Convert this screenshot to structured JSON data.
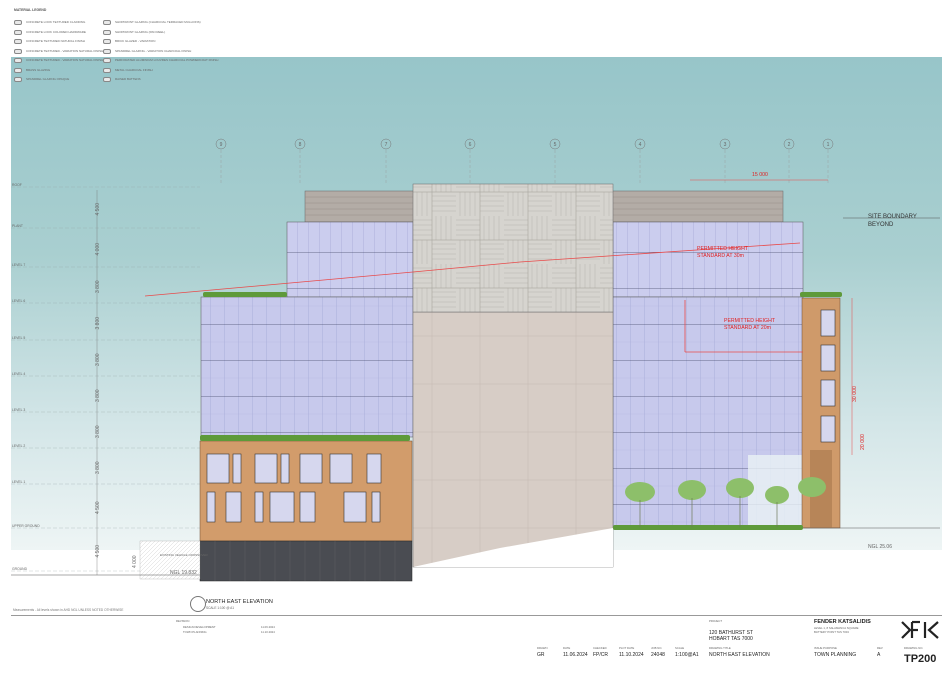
{
  "legend": {
    "title": "MATERIAL LEGEND",
    "col1": [
      "CONCRETE LOOK TEXTURED CLADDING",
      "CONCRETE LOOK COLORED HARDWARE",
      "CONCRETE TEXTURED NATURAL FINISH",
      "CONCRETE TEXTURED - VARIATION NATURAL FINISH",
      "CONCRETE TEXTURED - VARIATION NATURAL FINISH",
      "BRASS GLAZING",
      "SPANDREL GLAZING OPAQUE"
    ],
    "col2": [
      "SHOPFRONT GLAZING (CHARCOAL TERRACED MULLIONS)",
      "SHOPFRONT GLAZING (PAN REEL)",
      "BRICK GLAZED - VARIATION",
      "SPANDREL GLAZING - VARIATION CHARCOAL FINISH",
      "PERFORATED ALUMINIUM LOUVRES CHARCOAL POWDERCOAT FINISH",
      "METAL CHARCOAL FINISH",
      "RAISED BATTENS"
    ]
  },
  "grid_labels": [
    "9",
    "8",
    "7",
    "6",
    "5",
    "4",
    "3",
    "2",
    "1"
  ],
  "levels": [
    "ROOF",
    "PLANT",
    "LEVEL 7",
    "LEVEL 6",
    "LEVEL 5",
    "LEVEL 4",
    "LEVEL 3",
    "LEVEL 2",
    "LEVEL 1",
    "UPPER GROUND",
    "GROUND"
  ],
  "level_dims": [
    "4 500",
    "4 000",
    "3 800",
    "3 800",
    "3 800",
    "3 800",
    "3 800",
    "3 800",
    "4 500",
    "4 500"
  ],
  "annotations": {
    "site_boundary": "SITE BOUNDARY",
    "beyond": "BEYOND",
    "dim_top": "15 000",
    "height_30_line1": "PERMITTED HEIGHT",
    "height_30_line2": "STANDARD AT 30m",
    "height_20_line1": "PERMITTED HEIGHT",
    "height_20_line2": "STANDARD AT 20m",
    "dim_30000": "30 000",
    "dim_20000": "20 000",
    "ngl_right": "NGL 25.06",
    "ngl_left": "NGL 19.832",
    "dim_4000": "4 000",
    "existing_vehicle": "EXISTING VEHICLE CROSSOVER"
  },
  "drawing_title": "NORTH EAST ELEVATION",
  "drawing_scale": "SCALE 1:100 @ A1",
  "disclaimer": "Measurements - All levels shown in AHD NGL UNLESS NOTED OTHERWISE",
  "footer": {
    "revisions_label": "REVISION",
    "rev_rows": [
      "DESIGN DEVELOPMENT",
      "TOWN PLANNING"
    ],
    "rev_dates": [
      "11.06.2024",
      "11.10.2024"
    ],
    "drawn_label": "DRAWN",
    "drawn": "GR",
    "date_label": "DATE",
    "date": "11.06.2024",
    "checked_label": "CHECKED",
    "checked": "FP/CR",
    "plot_label": "PLOT DATE",
    "plot": "11.10.2024",
    "job_label": "JOB NO.",
    "job": "24048",
    "scale_label": "SCALE",
    "scale": "1:100@A1",
    "project_label": "PROJECT",
    "project_line1": "120 BATHURST ST",
    "project_line2": "HOBART TAS 7000",
    "drawing_label": "DRAWING TITLE",
    "drawing_title": "NORTH EAST ELEVATION",
    "firm": "FENDER KATSALIDIS",
    "firm_addr1": "LEVEL 1, 8 SALAMANCA SQUARE",
    "firm_addr2": "BATTERY POINT TAS 7004",
    "status_label": "ISSUE PURPOSE",
    "status": "TOWN PLANNING",
    "rev_label": "REV",
    "rev": "A",
    "drawing_no_label": "DRAWING NO.",
    "drawing_no": "TP200",
    "logo": "FK"
  },
  "colors": {
    "sky": "#a9cfd0",
    "glass": "#c9cbec",
    "timber": "#d09a6a",
    "concrete": "#d8cfc9",
    "red_line": "#e02020"
  }
}
